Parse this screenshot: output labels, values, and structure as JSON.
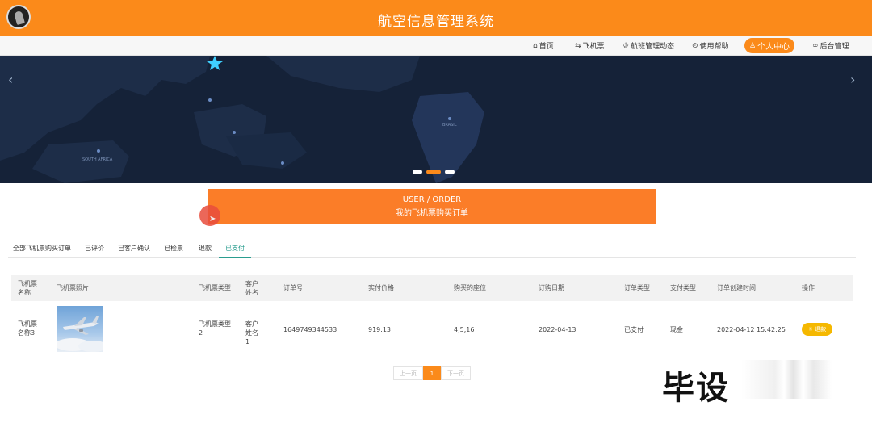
{
  "header": {
    "title": "航空信息管理系统"
  },
  "nav": {
    "items": [
      {
        "label": "首页",
        "icon": "home-icon"
      },
      {
        "label": "飞机票",
        "icon": "ticket-icon"
      },
      {
        "label": "航班管理动态",
        "icon": "graduation-cap-icon"
      },
      {
        "label": "使用帮助",
        "icon": "help-icon"
      },
      {
        "label": "个人中心",
        "icon": "user-icon",
        "active": true
      },
      {
        "label": "后台管理",
        "icon": "link-icon"
      }
    ]
  },
  "banner": {
    "map_labels": [
      "SOUTH AFRICA",
      "BRASIL"
    ]
  },
  "order_banner": {
    "line1": "USER / ORDER",
    "line2": "我的飞机票购买订单"
  },
  "tabs": [
    {
      "label": "全部飞机票购买订单"
    },
    {
      "label": "已评价"
    },
    {
      "label": "已客户确认"
    },
    {
      "label": "已检票"
    },
    {
      "label": "退款"
    },
    {
      "label": "已支付",
      "active": true
    }
  ],
  "table": {
    "headers": [
      "飞机票名称",
      "飞机票照片",
      "飞机票类型",
      "客户姓名",
      "订单号",
      "实付价格",
      "购买的座位",
      "订购日期",
      "订单类型",
      "支付类型",
      "订单创建时间",
      "操作"
    ],
    "rows": [
      {
        "name": "飞机票名称3",
        "type": "飞机票类型2",
        "customer": "客户姓名1",
        "order_no": "1649749344533",
        "price": "919.13",
        "seats": "4,5,16",
        "date": "2022-04-13",
        "order_type": "已支付",
        "pay_type": "现金",
        "created": "2022-04-12 15:42:25",
        "action": "退款"
      }
    ]
  },
  "pager": {
    "prev": "上一页",
    "current": "1",
    "next": "下一页"
  },
  "watermark": "毕设",
  "colors": {
    "accent": "#fb8a1a",
    "banner_bg": "#152238",
    "tab_active": "#2a9d8f",
    "button_yellow": "#f5b800"
  }
}
